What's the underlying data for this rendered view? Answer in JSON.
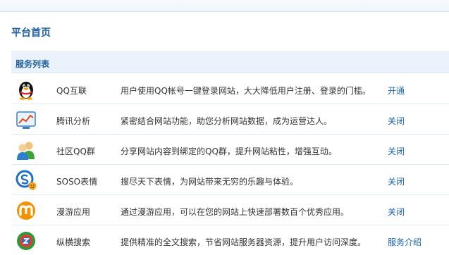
{
  "page": {
    "title": "平台首页"
  },
  "list": {
    "header": "服务列表",
    "rows": [
      {
        "icon": "qq-penguin-icon",
        "name": "QQ互联",
        "desc": "用户使用QQ帐号一键登录网站，大大降低用户注册、登录的门槛。",
        "action": "开通"
      },
      {
        "icon": "analytics-chart-icon",
        "name": "腾讯分析",
        "desc": "紧密结合网站功能，助您分析网站数据，成为运营达人。",
        "action": "关闭"
      },
      {
        "icon": "community-group-icon",
        "name": "社区QQ群",
        "desc": "分享网站内容到绑定的QQ群，提升网站粘性，增强互动。",
        "action": "关闭"
      },
      {
        "icon": "soso-emoticon-icon",
        "name": "SOSO表情",
        "desc": "搜尽天下表情，为网站带来无穷的乐趣与体验。",
        "action": "关闭"
      },
      {
        "icon": "manyou-apps-icon",
        "name": "漫游应用",
        "desc": "通过漫游应用，可以在您的网站上快速部署数百个优秀应用。",
        "action": "关闭"
      },
      {
        "icon": "zongheng-search-icon",
        "name": "纵横搜索",
        "desc": "提供精准的全文搜索，节省网站服务器资源，提升用户访问深度。",
        "action": "服务介绍"
      }
    ]
  },
  "colors": {
    "title": "#1f5f9c",
    "link": "#1a64b0",
    "header_bg": "#eaf3fb"
  }
}
